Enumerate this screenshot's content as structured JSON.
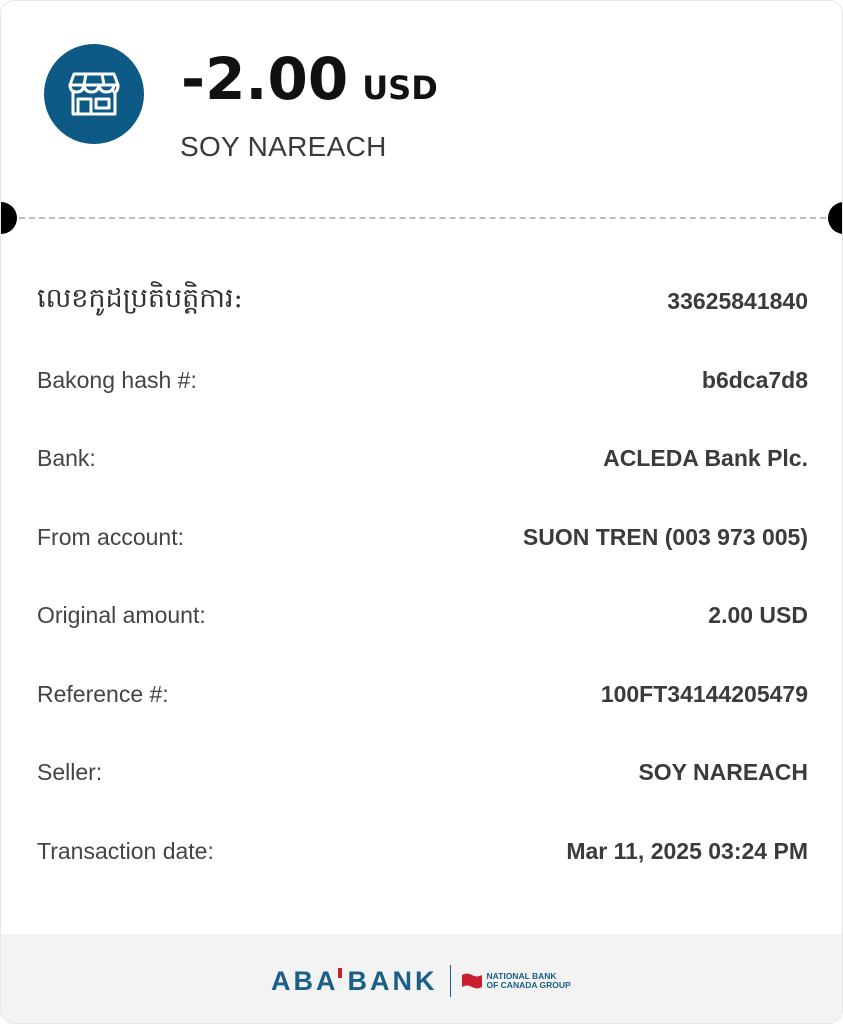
{
  "header": {
    "amount": "-2.00",
    "currency": "USD",
    "merchant": "SOY NAREACH",
    "icon": "store-icon"
  },
  "details": [
    {
      "label": "លេខកូដប្រតិបត្តិការ:",
      "value": "33625841840"
    },
    {
      "label": "Bakong hash #:",
      "value": "b6dca7d8"
    },
    {
      "label": "Bank:",
      "value": "ACLEDA Bank Plc."
    },
    {
      "label": "From account:",
      "value": "SUON TREN (003 973 005)"
    },
    {
      "label": "Original amount:",
      "value": "2.00 USD"
    },
    {
      "label": "Reference #:",
      "value": "100FT34144205479"
    },
    {
      "label": "Seller:",
      "value": "SOY NAREACH"
    },
    {
      "label": "Transaction date:",
      "value": "Mar 11, 2025 03:24 PM"
    }
  ],
  "footer": {
    "brand_left": "ABA",
    "brand_right": "BANK",
    "partner_line1": "NATIONAL BANK",
    "partner_line2": "OF CANADA GROUP"
  },
  "colors": {
    "brand_blue": "#0c5a85",
    "accent_red": "#c8202e"
  }
}
